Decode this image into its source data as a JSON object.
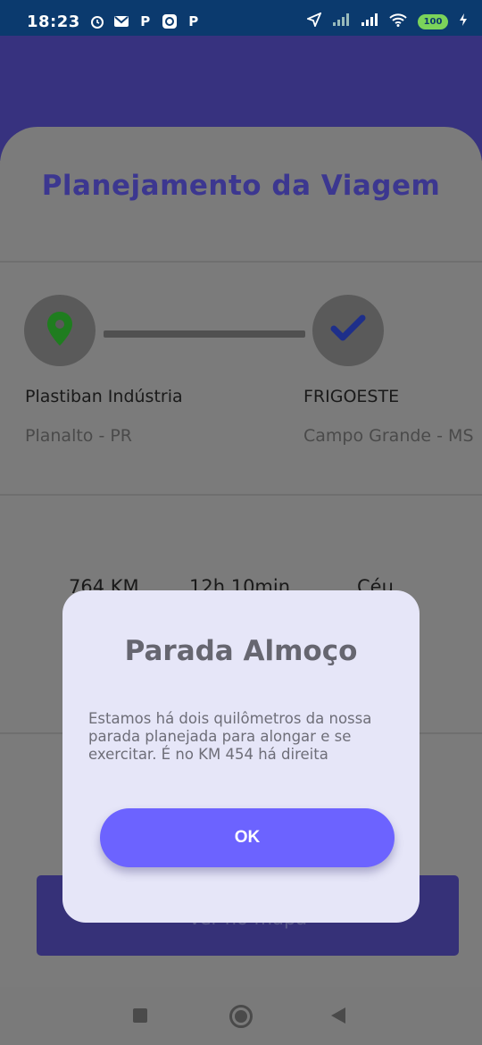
{
  "status_bar": {
    "time": "18:23",
    "battery": "100",
    "left_icons": [
      "alarm-icon",
      "mail-icon",
      "p-app-icon",
      "app-icon",
      "p-app-icon"
    ],
    "right_icons": [
      "location-arrow-icon",
      "signal-icon",
      "signal-icon",
      "wifi-icon",
      "battery-icon",
      "charging-icon"
    ]
  },
  "page": {
    "title": "Planejamento da Viagem"
  },
  "route": {
    "origin": {
      "name": "Plastiban Indústria",
      "city": "Planalto - PR",
      "icon": "map-pin-icon"
    },
    "destination": {
      "name": "FRIGOESTE",
      "city": "Campo Grande - MS",
      "icon": "checkmark-icon"
    }
  },
  "stats": {
    "distance": "764 KM",
    "duration": "12h 10min",
    "weather": "Céu"
  },
  "map_button": {
    "label": "Ver no mapa"
  },
  "dialog": {
    "title": "Parada Almoço",
    "message": "Estamos há dois quilômetros da nossa parada planejada para alongar e se exercitar. É no KM 454 há direita",
    "ok_label": "OK"
  },
  "colors": {
    "status_bar": "#0b3a6e",
    "header": "#37327f",
    "accent": "#6c63ff",
    "dialog_bg": "#e6e6f8",
    "title": "#3c3790"
  }
}
